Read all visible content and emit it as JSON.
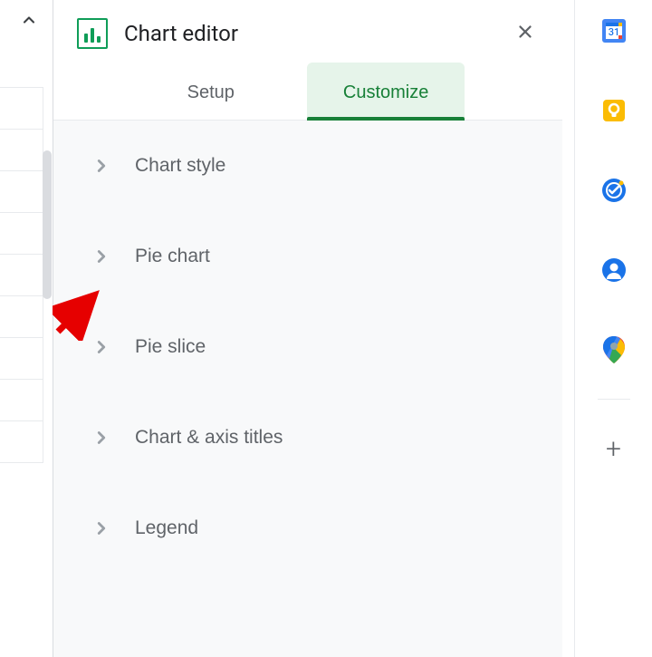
{
  "panel": {
    "title": "Chart editor",
    "tabs": {
      "setup": "Setup",
      "customize": "Customize"
    },
    "sections": [
      {
        "label": "Chart style"
      },
      {
        "label": "Pie chart"
      },
      {
        "label": "Pie slice"
      },
      {
        "label": "Chart & axis titles"
      },
      {
        "label": "Legend"
      }
    ]
  },
  "sideApps": {
    "calendar": "Calendar",
    "keep": "Keep",
    "tasks": "Tasks",
    "contacts": "Contacts",
    "maps": "Maps",
    "add": "+"
  }
}
